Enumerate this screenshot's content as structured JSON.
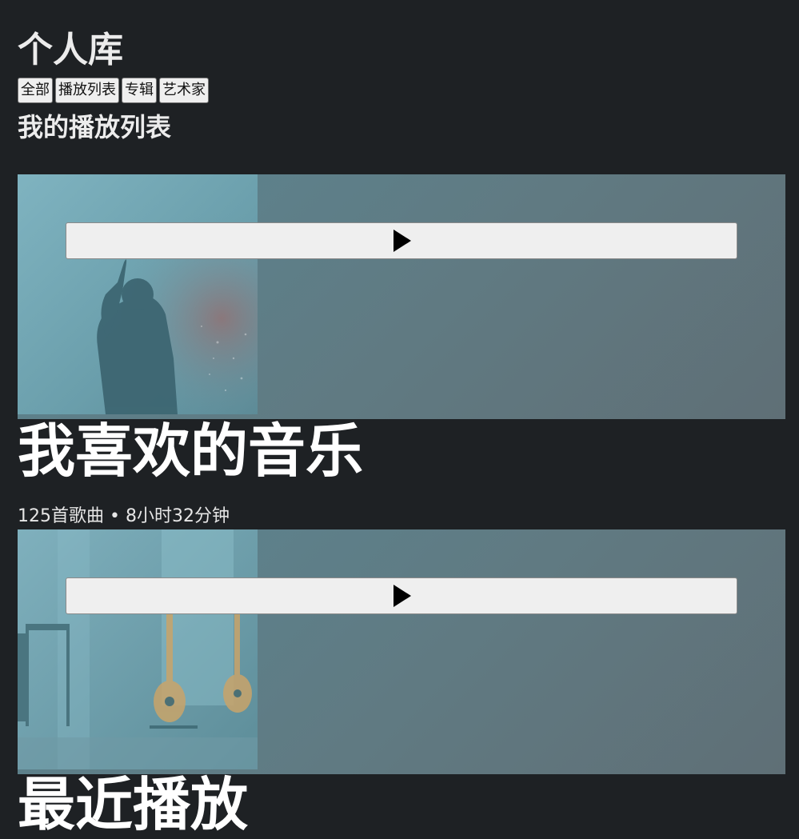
{
  "library": {
    "title": "个人库",
    "filters": [
      "全部",
      "播放列表",
      "专辑",
      "艺术家"
    ],
    "section_title": "我的播放列表"
  },
  "playlists": [
    {
      "name": "我喜欢的音乐",
      "meta": "125首歌曲 • 8小时32分钟",
      "cover_icon": "concert-singer-photo",
      "play_icon": "play-icon"
    },
    {
      "name": "最近播放",
      "cover_icon": "guitars-room-photo",
      "play_icon": "play-icon"
    }
  ],
  "colors": {
    "background": "#1e2124",
    "card_gradient_start": "#5b8591",
    "card_gradient_end": "#5f6f76",
    "text": "#ececec"
  }
}
